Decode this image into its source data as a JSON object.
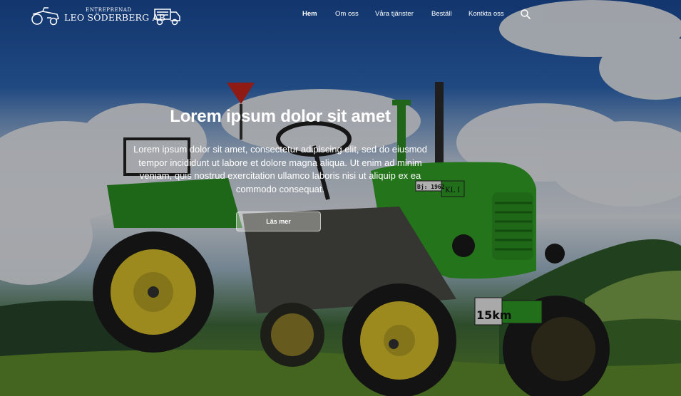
{
  "header": {
    "logo": {
      "top_line": "ENTREPRENAD",
      "main_line": "LEO SÖDERBERG AB"
    },
    "nav": [
      {
        "label": "Hem",
        "active": true
      },
      {
        "label": "Om oss",
        "active": false
      },
      {
        "label": "Våra tjänster",
        "active": false
      },
      {
        "label": "Beställ",
        "active": false
      },
      {
        "label": "Kontkta oss",
        "active": false
      }
    ],
    "search_icon": "search-icon"
  },
  "hero": {
    "title": "Lorem ipsum dolor sit amet",
    "lead": "Lorem ipsum dolor sit amet, consectetur adipiscing elit, sed do eiusmod tempor incididunt ut labore et dolore magna aliqua. Ut enim ad minim veniam, quis nostrud exercitation ullamco laboris nisi ut aliquip ex ea commodo consequat.",
    "cta_label": "Läs mer",
    "tractor_plates": {
      "year": "Bj: 1962",
      "code": "KL I",
      "speed": "15km"
    }
  },
  "colors": {
    "sky_top": "#1a4a98",
    "tractor_green": "#2e9a25",
    "wheel_yellow": "#d8c02a",
    "grass": "#5f8d2c"
  }
}
